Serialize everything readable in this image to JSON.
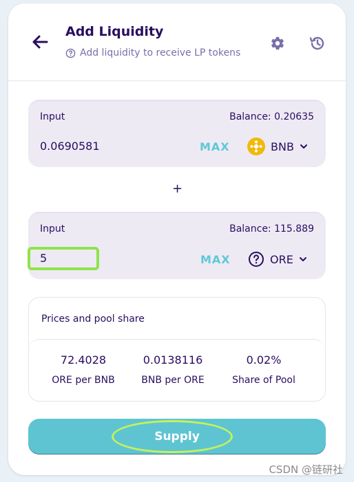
{
  "header": {
    "title": "Add Liquidity",
    "subtitle": "Add liquidity to receive LP tokens"
  },
  "input1": {
    "label": "Input",
    "balance": "Balance: 0.20635",
    "amount": "0.0690581",
    "max_label": "MAX",
    "token": "BNB",
    "token_icon": "bnb-icon"
  },
  "plus": "+",
  "input2": {
    "label": "Input",
    "balance": "Balance: 115.889",
    "amount": "5",
    "max_label": "MAX",
    "token": "ORE",
    "token_icon": "question-circle-icon"
  },
  "prices": {
    "title": "Prices and pool share",
    "items": [
      {
        "value": "72.4028",
        "label": "ORE per BNB"
      },
      {
        "value": "0.0138116",
        "label": "BNB per ORE"
      },
      {
        "value": "0.02%",
        "label": "Share of Pool"
      }
    ]
  },
  "supply_label": "Supply",
  "watermark": "CSDN @链研社",
  "colors": {
    "primary_text": "#280d5f",
    "accent": "#5ec4d2",
    "highlight": "#8ee34a",
    "panel_bg": "#eeeaf4"
  }
}
